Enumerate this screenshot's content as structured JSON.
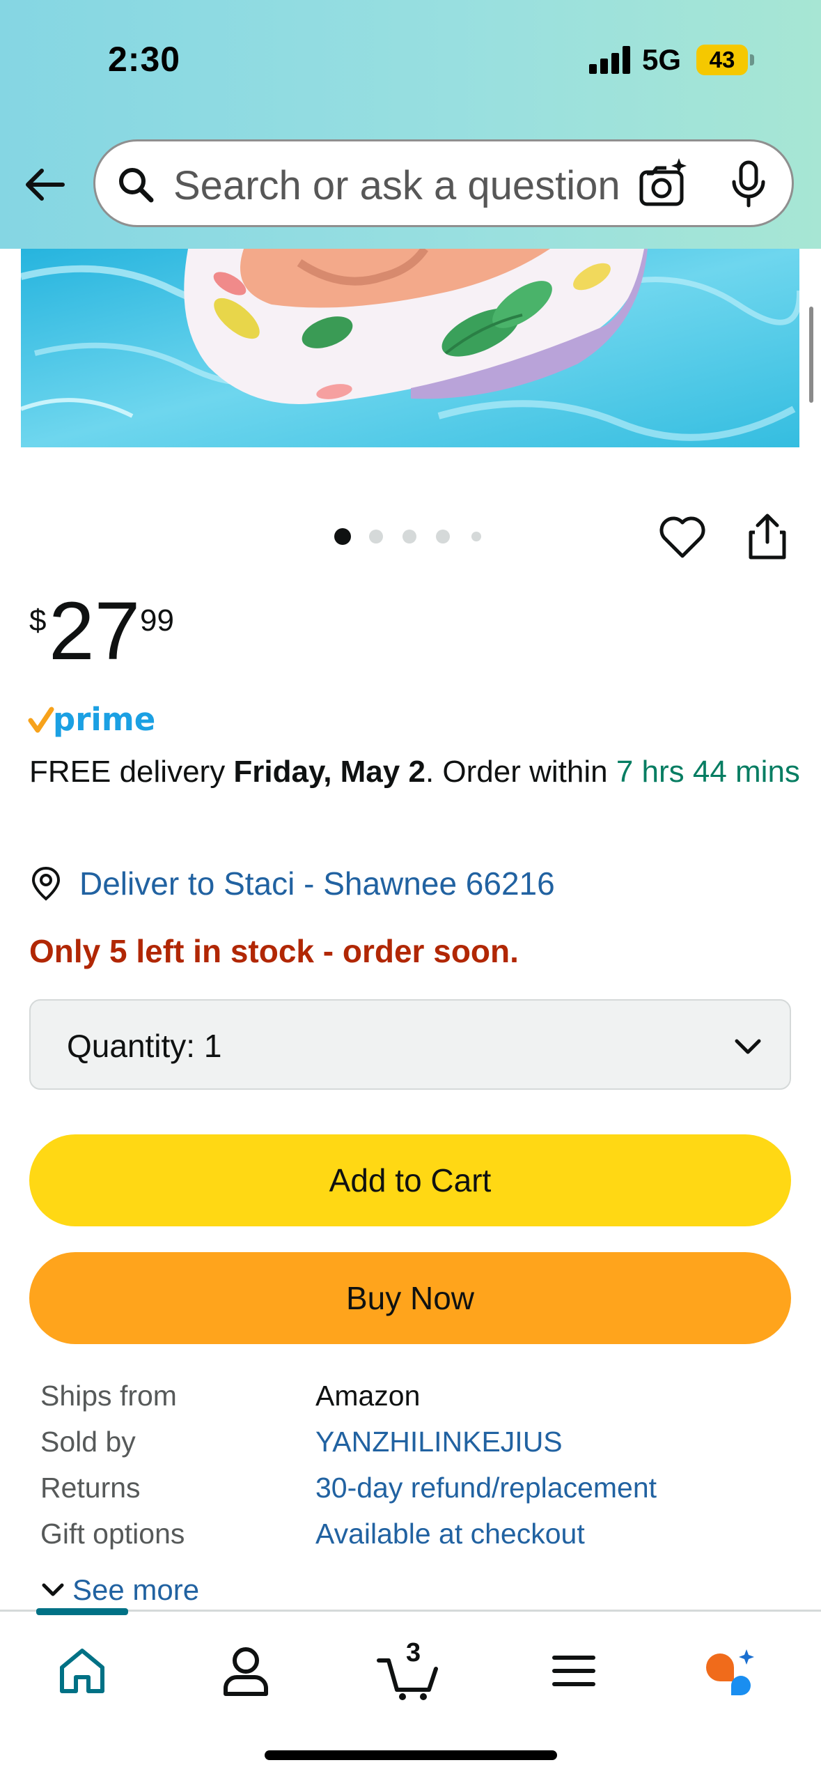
{
  "status_bar": {
    "time": "2:30",
    "network": "5G",
    "battery": "43"
  },
  "search": {
    "placeholder": "Search or ask a question",
    "icons": [
      "back-arrow-icon",
      "search-icon",
      "camera-lens-icon",
      "microphone-icon"
    ]
  },
  "gallery": {
    "image_count": 5,
    "active_index": 0
  },
  "product": {
    "price_symbol": "$",
    "price_whole": "27",
    "price_fraction": "99",
    "prime_label": "prime",
    "delivery_prefix": "FREE delivery ",
    "delivery_date": "Friday, May 2",
    "delivery_middle": ". Order within ",
    "delivery_window": "7 hrs 44 mins",
    "deliver_to": "Deliver to Staci - Shawnee 66216",
    "stock_message": "Only 5 left in stock - order soon.",
    "quantity_label": "Quantity:",
    "quantity_value": "1"
  },
  "actions": {
    "add_to_cart": "Add to Cart",
    "buy_now": "Buy Now"
  },
  "details": {
    "rows": [
      {
        "label": "Ships from",
        "value": "Amazon",
        "link": false
      },
      {
        "label": "Sold by",
        "value": "YANZHILINKEJIUS",
        "link": true
      },
      {
        "label": "Returns",
        "value": "30-day refund/replacement",
        "link": true
      },
      {
        "label": "Gift options",
        "value": "Available at checkout",
        "link": true
      }
    ],
    "see_more": "See more"
  },
  "tab_bar": {
    "cart_count": "3",
    "tabs": [
      "home-icon",
      "account-icon",
      "cart-icon",
      "menu-icon",
      "rufus-ai-icon"
    ]
  },
  "colors": {
    "header_gradient_start": "#85d6e3",
    "header_gradient_end": "#a7e6d4",
    "link": "#2162a1",
    "stock_red": "#b12704",
    "delivery_green": "#067d62",
    "add_to_cart_yellow": "#ffd814",
    "buy_now_orange": "#ffa41c",
    "prime_blue": "#1ba0e3",
    "tab_active": "#007185"
  }
}
